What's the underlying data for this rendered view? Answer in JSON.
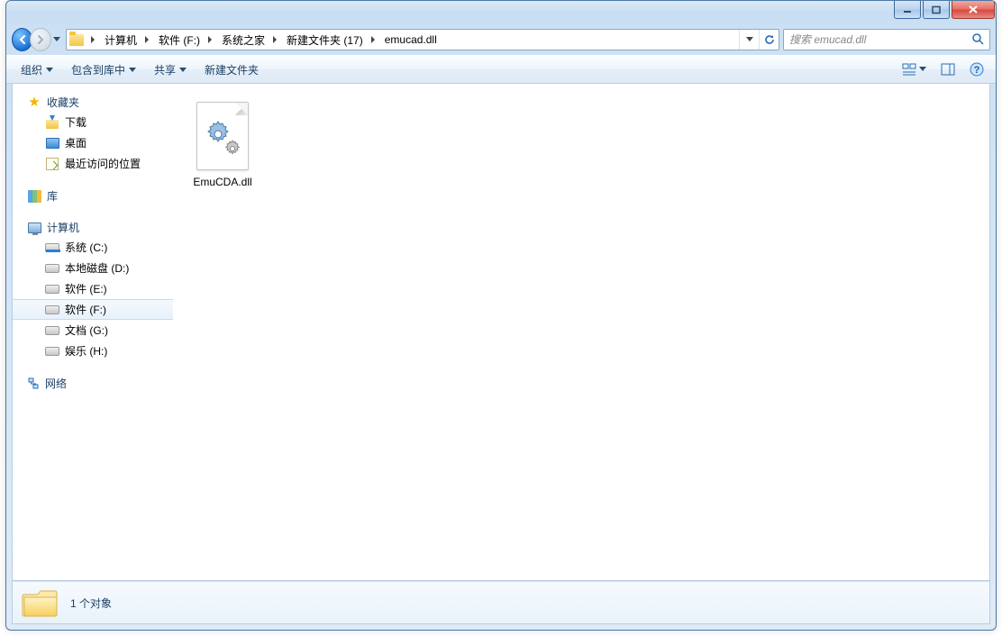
{
  "breadcrumbs": [
    "计算机",
    "软件 (F:)",
    "系统之家",
    "新建文件夹 (17)",
    "emucad.dll"
  ],
  "search": {
    "placeholder": "搜索 emucad.dll"
  },
  "toolbar": {
    "organize": "组织",
    "include": "包含到库中",
    "share": "共享",
    "new_folder": "新建文件夹"
  },
  "sidebar": {
    "favorites": {
      "label": "收藏夹",
      "items": [
        "下载",
        "桌面",
        "最近访问的位置"
      ]
    },
    "libraries": {
      "label": "库"
    },
    "computer": {
      "label": "计算机",
      "drives": [
        "系统 (C:)",
        "本地磁盘 (D:)",
        "软件 (E:)",
        "软件 (F:)",
        "文档 (G:)",
        "娱乐 (H:)"
      ],
      "selected_index": 3
    },
    "network": {
      "label": "网络"
    }
  },
  "files": [
    {
      "name": "EmuCDA.dll"
    }
  ],
  "status": {
    "text": "1 个对象"
  }
}
